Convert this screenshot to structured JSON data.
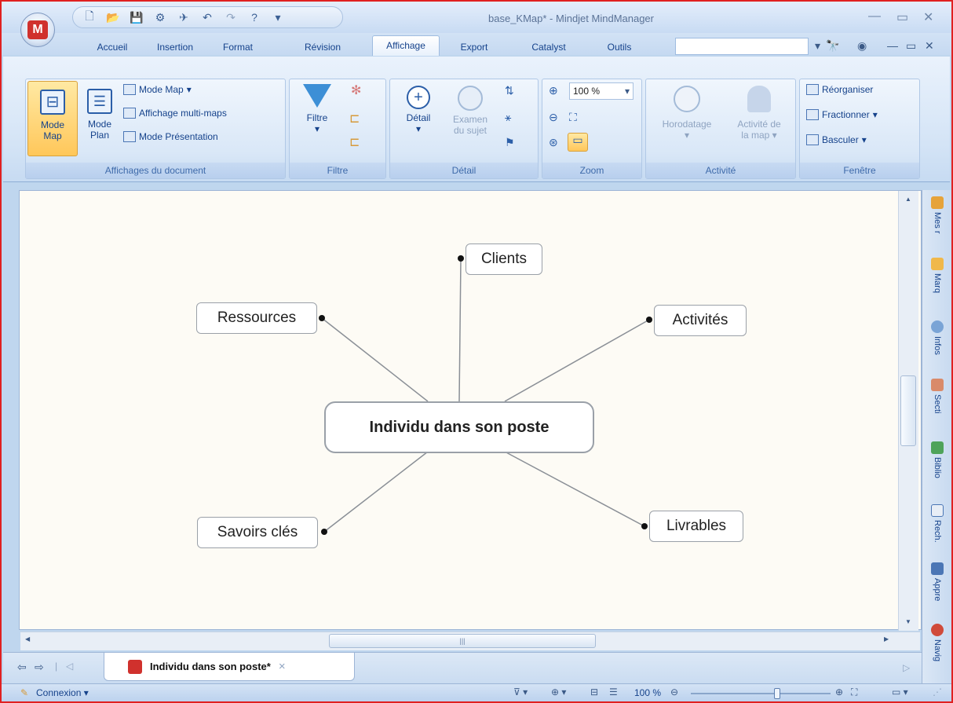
{
  "window": {
    "title": "base_KMap* - Mindjet MindManager"
  },
  "tabs": [
    "Accueil",
    "Insertion",
    "Format",
    "Révision",
    "Affichage",
    "Export",
    "Catalyst",
    "Outils"
  ],
  "active_tab": "Affichage",
  "ribbon": {
    "affichages": {
      "mode_map_big": "Mode\nMap",
      "mode_map_line1": "Mode",
      "mode_map_line2": "Map",
      "mode_plan_line1": "Mode",
      "mode_plan_line2": "Plan",
      "mode_map_menu": "Mode Map",
      "multi_maps": "Affichage multi-maps",
      "presentation": "Mode Présentation",
      "label": "Affichages du document"
    },
    "filtre": {
      "filtre": "Filtre",
      "label": "Filtre"
    },
    "detail": {
      "detail": "Détail",
      "examen_line1": "Examen",
      "examen_line2": "du sujet",
      "label": "Détail"
    },
    "zoom": {
      "value": "100 %",
      "label": "Zoom"
    },
    "activite": {
      "horodatage": "Horodatage",
      "activite_line1": "Activité de",
      "activite_line2": "la map",
      "label": "Activité"
    },
    "fenetre": {
      "reorganiser": "Réorganiser",
      "fractionner": "Fractionner",
      "basculer": "Basculer",
      "label": "Fenêtre"
    }
  },
  "map": {
    "central": "Individu dans son poste",
    "topics": {
      "clients": "Clients",
      "ressources": "Ressources",
      "activites": "Activités",
      "savoirs": "Savoirs clés",
      "livrables": "Livrables"
    }
  },
  "side_panel": [
    "Mes r",
    "Marq",
    "Infos",
    "Secti",
    "Biblio",
    "Rech.",
    "Appre",
    "Navig"
  ],
  "doc_tab": {
    "title": "Individu dans son poste*",
    "close": "×"
  },
  "status": {
    "connexion": "Connexion",
    "zoom": "100 %"
  }
}
